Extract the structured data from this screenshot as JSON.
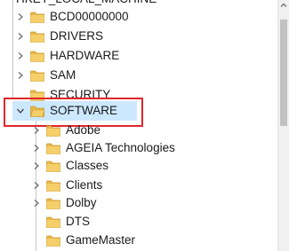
{
  "tree": {
    "root_label": "HKEY_LOCAL_MACHINE",
    "items": [
      {
        "label": "BCD00000000",
        "expanded": false
      },
      {
        "label": "DRIVERS",
        "expanded": false
      },
      {
        "label": "HARDWARE",
        "expanded": false
      },
      {
        "label": "SAM",
        "expanded": false
      },
      {
        "label": "SECURITY",
        "expanded": false
      },
      {
        "label": "SOFTWARE",
        "expanded": true,
        "selected": true
      },
      {
        "label": "Adobe",
        "expanded": false
      },
      {
        "label": "AGEIA Technologies",
        "expanded": false
      },
      {
        "label": "Classes",
        "expanded": false
      },
      {
        "label": "Clients",
        "expanded": false
      },
      {
        "label": "Dolby",
        "expanded": false
      },
      {
        "label": "DTS",
        "expanded": false
      },
      {
        "label": "GameMaster",
        "expanded": false
      }
    ]
  },
  "colors": {
    "folder": "#e8b84a",
    "highlight_border": "#e0262b",
    "selection": "#cce8ff"
  },
  "icons": {
    "collapsed": "chevron-right-icon",
    "expanded": "chevron-down-icon",
    "folder": "folder-icon"
  }
}
